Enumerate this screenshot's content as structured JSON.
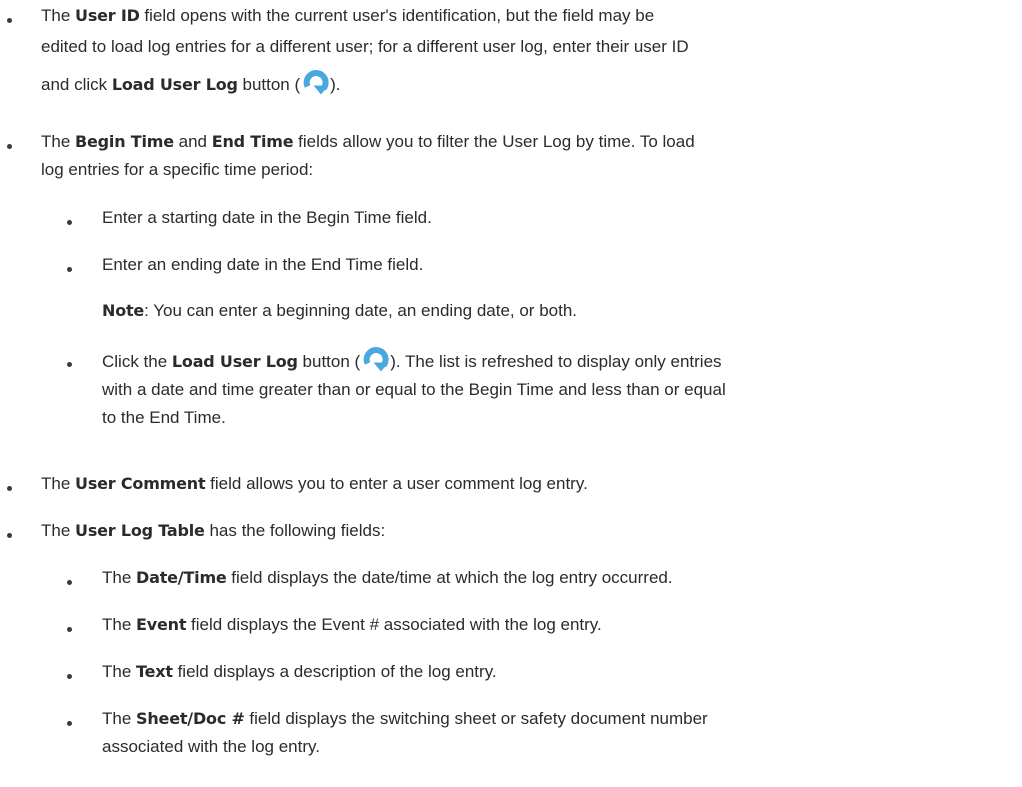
{
  "items": {
    "user_id": {
      "p1": "The ",
      "b1": "User ID",
      "p2": " field opens with the current user's identification, but the field may be",
      "p3": "edited to load log entries for a different user; for a different user log, enter their user ID",
      "p4": "and click ",
      "b2": "Load User Log",
      "p5": " button (",
      "p6": ")."
    },
    "begin_end": {
      "p1": "The ",
      "b1": "Begin Time",
      "p2": " and ",
      "b2": "End Time",
      "p3": " fields allow you to filter the User Log by time. To load",
      "p4": "log entries for a specific time period:"
    },
    "sub_begin": "Enter a starting date in the Begin Time field.",
    "sub_end": "Enter an ending date in the End Time field.",
    "note": {
      "label": "Note",
      "text": ": You can enter a beginning date, an ending date, or both."
    },
    "click_load": {
      "p1": "Click the ",
      "b1": "Load User Log",
      "p2": " button (",
      "p3": "). The list is refreshed to display only entries",
      "p4": "with a date and time greater than or equal to the Begin Time and less than or equal",
      "p5": "to the End Time."
    },
    "user_comment": {
      "p1": "The ",
      "b1": "User Comment",
      "p2": " field allows you to enter a user comment log entry."
    },
    "user_log_table": {
      "p1": "The ",
      "b1": "User Log Table",
      "p2": " has the following fields:"
    },
    "date_time": {
      "p1": "The ",
      "b1": "Date/Time",
      "p2": " field displays the date/time at which the log entry occurred."
    },
    "event": {
      "p1": "The ",
      "b1": "Event",
      "p2": " field displays the Event # associated with the log entry."
    },
    "text_field": {
      "p1": "The ",
      "b1": "Text",
      "p2": " field displays a description of the log entry."
    },
    "sheet_doc": {
      "p1": "The ",
      "b1": "Sheet/Doc #",
      "p2": " field displays the switching sheet or safety document number",
      "p3": "associated with the log entry."
    }
  },
  "icons": {
    "reload": "reload-icon",
    "bullet": "bullet-icon"
  },
  "colors": {
    "text": "#2b2b2b",
    "icon": "#4aa8e0"
  }
}
